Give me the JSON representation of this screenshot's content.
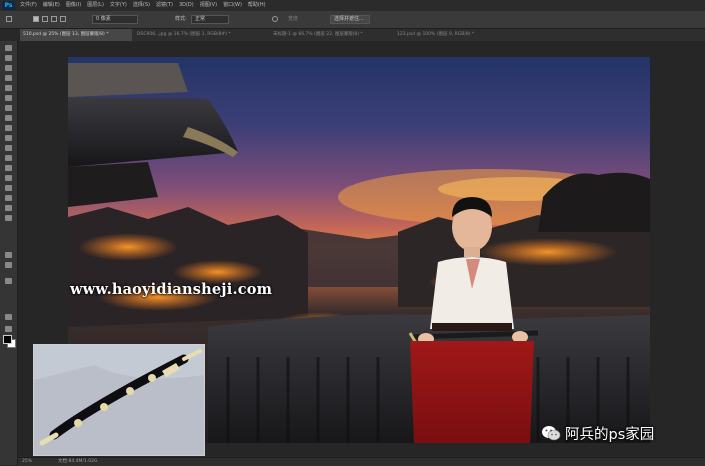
{
  "app": {
    "logo": "Ps"
  },
  "menu": [
    "文件(F)",
    "编辑(E)",
    "图像(I)",
    "图层(L)",
    "文字(Y)",
    "选择(S)",
    "滤镜(T)",
    "3D(D)",
    "视图(V)",
    "窗口(W)",
    "帮助(H)"
  ],
  "options_bar": {
    "feather_value": "0 像素",
    "style_label": "样式:",
    "style_value": "正常",
    "width_label": "宽度",
    "select_mask_button": "选择并遮住..."
  },
  "tabs": [
    {
      "label": "510.psd @ 25% (图层 13, 图层蒙版/8) *",
      "active": true
    },
    {
      "label": "DSC906...jpg @ 16.7% (图层 1, RGB/8#) *",
      "active": false
    },
    {
      "label": "未标题-1 @ 66.7% (图层 22, 图层蒙版/8) *",
      "active": false
    },
    {
      "label": "123.psd @ 100% (图层 0, RGB/8) *",
      "active": false
    }
  ],
  "watermark": "www.haoyidiansheji.com",
  "brand": {
    "text": "阿兵的ps家园",
    "icon": "wechat-icon"
  },
  "statusbar": {
    "zoom": "25%",
    "doc_info": "文档:84.4M/1.02G"
  },
  "colors": {
    "foreground": "#000000",
    "background": "#ffffff",
    "accent": "#31a8ff"
  }
}
